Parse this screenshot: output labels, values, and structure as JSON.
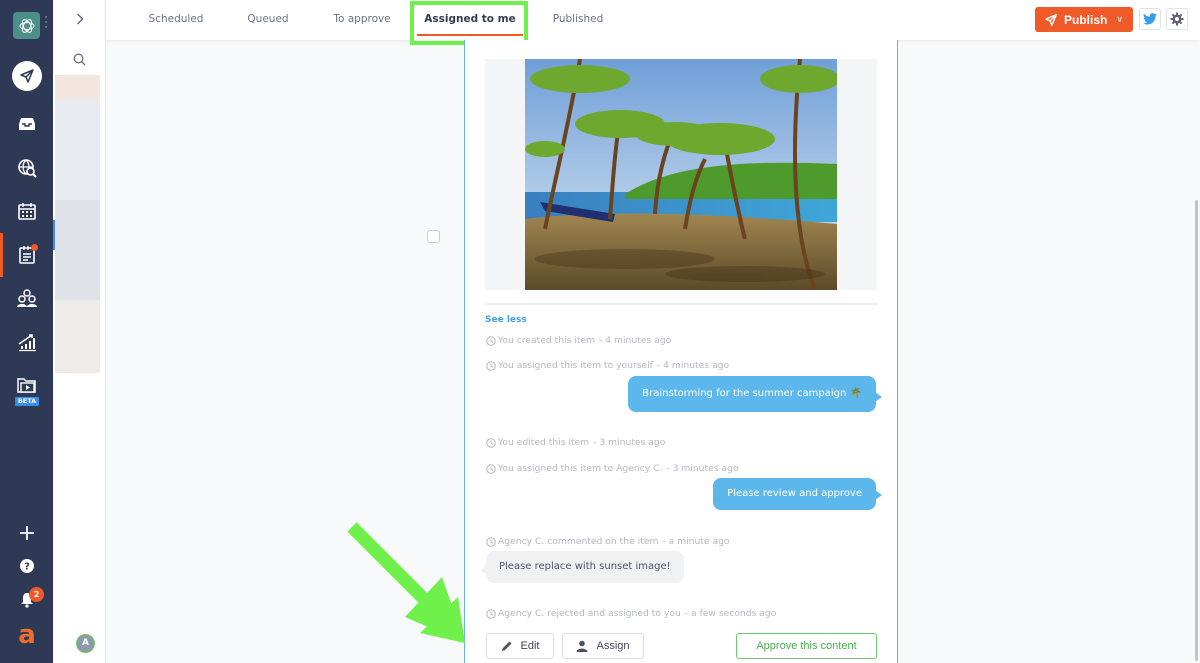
{
  "rail": {
    "items": [
      {
        "name": "compose",
        "icon": "paper-plane-icon"
      },
      {
        "name": "inbox",
        "icon": "inbox-tray-icon"
      },
      {
        "name": "listening",
        "icon": "globe-search-icon"
      },
      {
        "name": "calendar",
        "icon": "calendar-icon"
      },
      {
        "name": "content",
        "icon": "notepad-icon",
        "active": true,
        "notification_dot": true
      },
      {
        "name": "team",
        "icon": "people-icon"
      },
      {
        "name": "analytics",
        "icon": "chart-trend-icon"
      },
      {
        "name": "video",
        "icon": "video-folder-icon"
      }
    ],
    "beta_label": "BETA",
    "bell_badge": "2",
    "brand_letter": "a",
    "accent_color": "#f05a28"
  },
  "subcol": {
    "avatar_letter": "A"
  },
  "tabs": [
    {
      "label": "Scheduled",
      "active": false
    },
    {
      "label": "Queued",
      "active": false
    },
    {
      "label": "To approve",
      "active": false
    },
    {
      "label": "Assigned to me",
      "active": true
    },
    {
      "label": "Published",
      "active": false
    }
  ],
  "toolbar": {
    "publish_label": "Publish",
    "publish_color": "#f05a28"
  },
  "card": {
    "image_alt": "Tropical beach with palm trees and a boat",
    "see_less": "See less",
    "activity": [
      {
        "type": "log",
        "text": "You created this item",
        "time": " - 4 minutes ago"
      },
      {
        "type": "log",
        "text": "You assigned this item to yourself",
        "time": " - 4 minutes ago"
      },
      {
        "type": "comment-out",
        "text": "Brainstorming for the summer campaign 🌴"
      },
      {
        "type": "log",
        "text": "You edited this item",
        "time": " - 3 minutes ago"
      },
      {
        "type": "log",
        "text": "You assigned this item to Agency C.",
        "time": " - 3 minutes ago"
      },
      {
        "type": "comment-out",
        "text": "Please review and approve"
      },
      {
        "type": "log",
        "text": "Agency C. commented on the item",
        "time": " - a minute ago"
      },
      {
        "type": "comment-in",
        "text": "Please replace with sunset image!"
      },
      {
        "type": "log",
        "text": "Agency C. rejected and assigned to you",
        "time": " - a few seconds ago"
      }
    ],
    "edit_label": "Edit",
    "assign_label": "Assign",
    "approve_label": "Approve this content"
  },
  "annotation": {
    "highlight_color": "#6ff04a"
  }
}
